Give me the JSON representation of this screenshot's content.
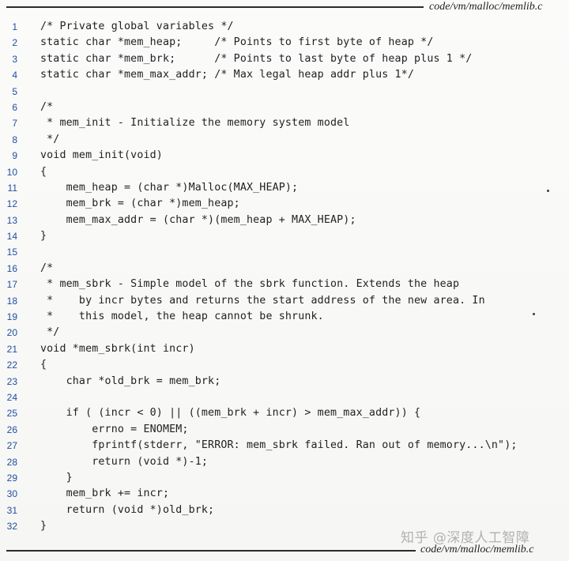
{
  "header": {
    "file_label": "code/vm/malloc/memlib.c"
  },
  "footer": {
    "file_label": "code/vm/malloc/memlib.c"
  },
  "watermark": {
    "text": "知乎 @深度人工智障"
  },
  "code": {
    "lines": [
      {
        "number": "1",
        "text": "/* Private global variables */"
      },
      {
        "number": "2",
        "text": "static char *mem_heap;     /* Points to first byte of heap */"
      },
      {
        "number": "3",
        "text": "static char *mem_brk;      /* Points to last byte of heap plus 1 */"
      },
      {
        "number": "4",
        "text": "static char *mem_max_addr; /* Max legal heap addr plus 1*/"
      },
      {
        "number": "5",
        "text": ""
      },
      {
        "number": "6",
        "text": "/*"
      },
      {
        "number": "7",
        "text": " * mem_init - Initialize the memory system model"
      },
      {
        "number": "8",
        "text": " */"
      },
      {
        "number": "9",
        "text": "void mem_init(void)"
      },
      {
        "number": "10",
        "text": "{"
      },
      {
        "number": "11",
        "text": "    mem_heap = (char *)Malloc(MAX_HEAP);"
      },
      {
        "number": "12",
        "text": "    mem_brk = (char *)mem_heap;"
      },
      {
        "number": "13",
        "text": "    mem_max_addr = (char *)(mem_heap + MAX_HEAP);"
      },
      {
        "number": "14",
        "text": "}"
      },
      {
        "number": "15",
        "text": ""
      },
      {
        "number": "16",
        "text": "/*"
      },
      {
        "number": "17",
        "text": " * mem_sbrk - Simple model of the sbrk function. Extends the heap"
      },
      {
        "number": "18",
        "text": " *    by incr bytes and returns the start address of the new area. In"
      },
      {
        "number": "19",
        "text": " *    this model, the heap cannot be shrunk."
      },
      {
        "number": "20",
        "text": " */"
      },
      {
        "number": "21",
        "text": "void *mem_sbrk(int incr)"
      },
      {
        "number": "22",
        "text": "{"
      },
      {
        "number": "23",
        "text": "    char *old_brk = mem_brk;"
      },
      {
        "number": "24",
        "text": ""
      },
      {
        "number": "25",
        "text": "    if ( (incr < 0) || ((mem_brk + incr) > mem_max_addr)) {"
      },
      {
        "number": "26",
        "text": "        errno = ENOMEM;"
      },
      {
        "number": "27",
        "text": "        fprintf(stderr, \"ERROR: mem_sbrk failed. Ran out of memory...\\n\");"
      },
      {
        "number": "28",
        "text": "        return (void *)-1;"
      },
      {
        "number": "29",
        "text": "    }"
      },
      {
        "number": "30",
        "text": "    mem_brk += incr;"
      },
      {
        "number": "31",
        "text": "    return (void *)old_brk;"
      },
      {
        "number": "32",
        "text": "}"
      }
    ]
  }
}
